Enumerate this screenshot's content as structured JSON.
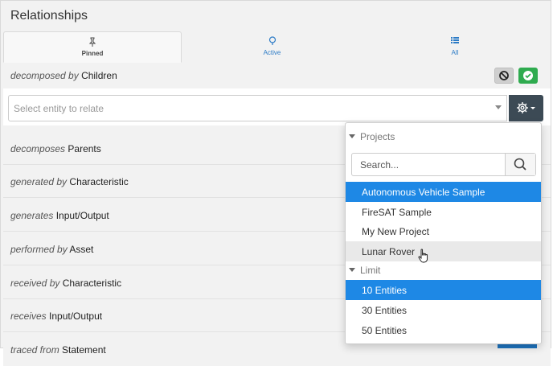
{
  "panel": {
    "title": "Relationships"
  },
  "tabs": [
    {
      "label": "Pinned",
      "icon": "pin-icon",
      "active": true
    },
    {
      "label": "Active",
      "icon": "lightbulb-icon",
      "active": false
    },
    {
      "label": "All",
      "icon": "list-icon",
      "active": false
    }
  ],
  "header_row": {
    "verb": "decomposed by",
    "entity": "Children"
  },
  "select": {
    "placeholder": "Select entity to relate"
  },
  "rows": [
    {
      "verb": "decomposes",
      "entity": "Parents"
    },
    {
      "verb": "generated by",
      "entity": "Characteristic"
    },
    {
      "verb": "generates",
      "entity": "Input/Output"
    },
    {
      "verb": "performed by",
      "entity": "Asset"
    },
    {
      "verb": "received by",
      "entity": "Characteristic"
    },
    {
      "verb": "receives",
      "entity": "Input/Output"
    },
    {
      "verb": "traced from",
      "entity": "Statement"
    }
  ],
  "dropdown": {
    "projects_header": "Projects",
    "search_placeholder": "Search...",
    "projects": [
      {
        "label": "Autonomous Vehicle Sample",
        "state": "selected"
      },
      {
        "label": "FireSAT Sample",
        "state": ""
      },
      {
        "label": "My New Project",
        "state": ""
      },
      {
        "label": "Lunar Rover",
        "state": "hover"
      }
    ],
    "limit_header": "Limit",
    "limits": [
      {
        "label": "10 Entities",
        "state": "selected"
      },
      {
        "label": "30 Entities",
        "state": ""
      },
      {
        "label": "50 Entities",
        "state": ""
      }
    ]
  },
  "colors": {
    "selected": "#1e88e5",
    "confirm": "#2fab4f",
    "gear_button": "#3c4a55",
    "tab_link": "#2c7bc6"
  }
}
